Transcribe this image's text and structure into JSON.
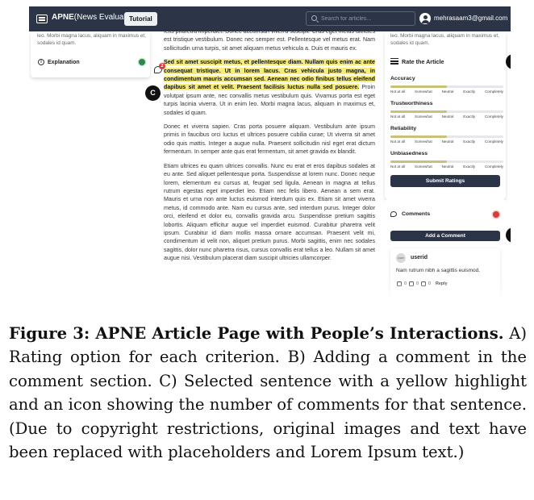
{
  "navbar": {
    "brand_name": "APNE",
    "brand_suffix": "(News Evaluation)",
    "tutorial_label": "Tutorial",
    "search_placeholder": "Search for articles...",
    "user_email": "mehrasaam3@gmail.com"
  },
  "left_panel": {
    "text": "leo. Morbi magna lacus, aliquam in maximus et, sodales id quam.",
    "explanation_label": "Explanation",
    "info_glyph": "i"
  },
  "article": {
    "para_top": "felis pharetra imperdiet. Donec accumsan viverra suscipit. Cras eget metus ultricies est tristique vestibulum. Donec nec semper est. Pellentesque vel metus erat. Nam sollicitudin urna turpis, sit amet aliquam metus vehicula a. Duis et mauris ex.",
    "para_highlight_marked": "Sed sit amet suscipit metus, et pellentesque diam. Nullam quis enim ac ante consequat tristique. Ut in lorem lacus. Cras vehicula justo magna, in condimentum mauris accumsan sed. Aenean nec odio finibus tellus eleifend dapibus sit amet et velit. Praesent facilisis luctus nulla sed posuere.",
    "para_highlight_rest": " Proin volutpat ipsum ante, nec convallis metus vestibulum quis. Vivamus porta est eget turpis lacinia viverra. Ut in enim leo. Morbi magna lacus, aliquam in maximus et, sodales id quam.",
    "para_3": "Donec et viverra sapien. Cras porta posuere aliquam. Vestibulum ante ipsum primis in faucibus orci luctus et ultrices posuere cubilia curae; Ut viverra sit amet odio quis mattis. Integer a augue nulla. Praesent sollicitudin nisl eget erat dictum fermentum. In semper ante quis erat fermentum, sit amet gravida ex blandit.",
    "para_4": "Etiam ultrices eu quam ultrices convallis. Nunc eu erat et eros dapibus sodales at eu ante. Sed aliquet pellentesque porta. Suspendisse at lorem nunc. Donec neque lorem, elementum eu cursus at, feugiat sed ligula. Aenean in magna at tellus rutrum egestas eget imperdiet leo. Etiam nec felis libero. Aenean a sem erat. Mauris et urna non ante luctus euismod interdum quis ex. Etiam sit amet viverra metus, id commodo ante. Nam eu cursus ante, sed interdum purus. Integer dolor orci, eleifend et dolor eu, convallis gravida arcu. Suspendisse pretium sagittis lobortis. Aliquam efficitur augue vel imperdiet euismod. Curabitur pharetra velit ipsum. Curabitur id diam mollis massa ornare accumsan. Praesent velit mi, condimentum id velit non, aliquet pretium purus. Morbi sagittis, enim nec sodales sagittis, dolor nunc pharetra risus, cursus convallis erat tellus a leo. Nullam sit amet augue nisi. Vestibulum placerat diam suscipit ultricies ullamcorper.",
    "comment_count": "2"
  },
  "callouts": {
    "a": "A",
    "b": "B",
    "c": "C"
  },
  "rating_panel": {
    "top_text": "leo. Morbi magna lacus, aliquam in maximus et, sodales id quam.",
    "heading": "Rate the Article",
    "scale_labels": [
      "Not at all",
      "Somewhat",
      "Neutral",
      "Exactly",
      "Completely"
    ],
    "criteria": [
      {
        "name": "Accuracy",
        "fill_fraction": 0.5
      },
      {
        "name": "Trustworthiness",
        "fill_fraction": 0.5
      },
      {
        "name": "Reliability",
        "fill_fraction": 0.5
      },
      {
        "name": "Unbiasedness",
        "fill_fraction": 0.5
      }
    ],
    "submit_label": "Submit Ratings"
  },
  "comments_panel": {
    "heading": "Comments",
    "add_label": "Add a Comment",
    "comment": {
      "avatar_text": "user",
      "user": "userid",
      "text": "Nam rutrum nibh a sagittis euismod.",
      "likes": "0",
      "dislikes": "0",
      "replies": "0",
      "reply_label": "Reply"
    }
  },
  "caption": {
    "label": "Figure 3: APNE Article Page with People’s Interactions.",
    "text": " A) Rating option for each criterion. B) Adding a comment in the comment section. C) Selected sentence with a yellow highlight and an icon showing the number of comments for that sentence. (Due to copyright restrictions, original images and text have been replaced with placeholders and Lorem Ipsum text.)"
  },
  "colors": {
    "navbar": "#2c3548",
    "highlight": "#f6ec7a",
    "toggle_on": "#2a8a4b",
    "toggle_off": "#d83b3b",
    "badge": "#e03a3a"
  }
}
